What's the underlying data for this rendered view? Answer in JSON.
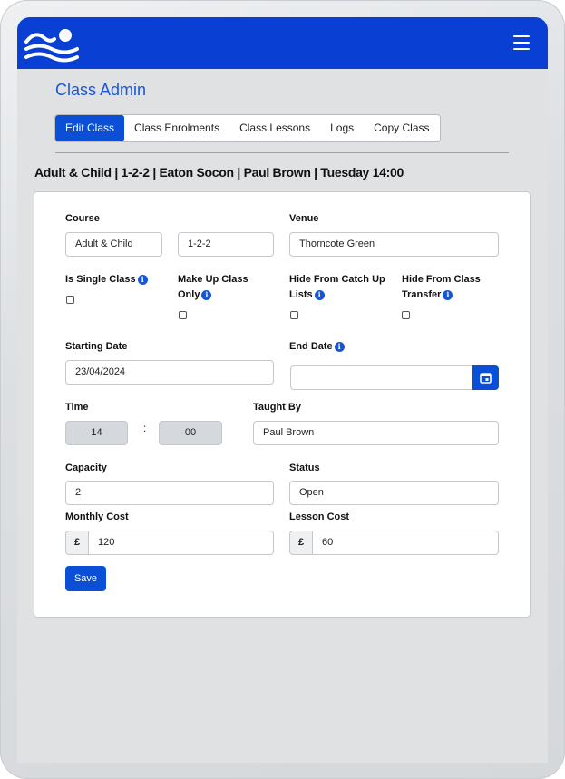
{
  "header": {
    "logo_icon": "wave-logo-icon",
    "menu_icon": "hamburger-icon"
  },
  "page": {
    "title": "Class Admin"
  },
  "tabs": [
    {
      "label": "Edit Class",
      "active": true
    },
    {
      "label": "Class Enrolments"
    },
    {
      "label": "Class Lessons"
    },
    {
      "label": "Logs"
    },
    {
      "label": "Copy Class"
    }
  ],
  "class_summary": "Adult & Child | 1-2-2 | Eaton Socon | Paul Brown | Tuesday 14:00",
  "form": {
    "course_label": "Course",
    "course_value": "Adult & Child",
    "course_code_value": "1-2-2",
    "venue_label": "Venue",
    "venue_value": "Thorncote Green",
    "single_class_label": "Is Single Class",
    "makeup_label_1": "Make Up Class",
    "makeup_label_2": "Only",
    "hide_catchup_label_1": "Hide From Catch Up",
    "hide_catchup_label_2": "Lists",
    "hide_transfer_label_1": "Hide From Class",
    "hide_transfer_label_2": "Transfer",
    "starting_date_label": "Starting Date",
    "starting_date_value": "23/04/2024",
    "end_date_label": "End Date",
    "end_date_value": "",
    "time_label": "Time",
    "time_hour": "14",
    "time_sep": ":",
    "time_minute": "00",
    "taught_by_label": "Taught By",
    "taught_by_value": "Paul Brown",
    "capacity_label": "Capacity",
    "capacity_value": "2",
    "status_label": "Status",
    "status_value": "Open",
    "monthly_cost_label": "Monthly Cost",
    "currency_symbol": "£",
    "monthly_cost_value": "120",
    "lesson_cost_label": "Lesson Cost",
    "lesson_cost_value": "60",
    "save_label": "Save",
    "info_glyph": "i"
  },
  "colors": {
    "brand": "#0a3fd4",
    "accent": "#0a4fd6",
    "title": "#1a56db"
  }
}
